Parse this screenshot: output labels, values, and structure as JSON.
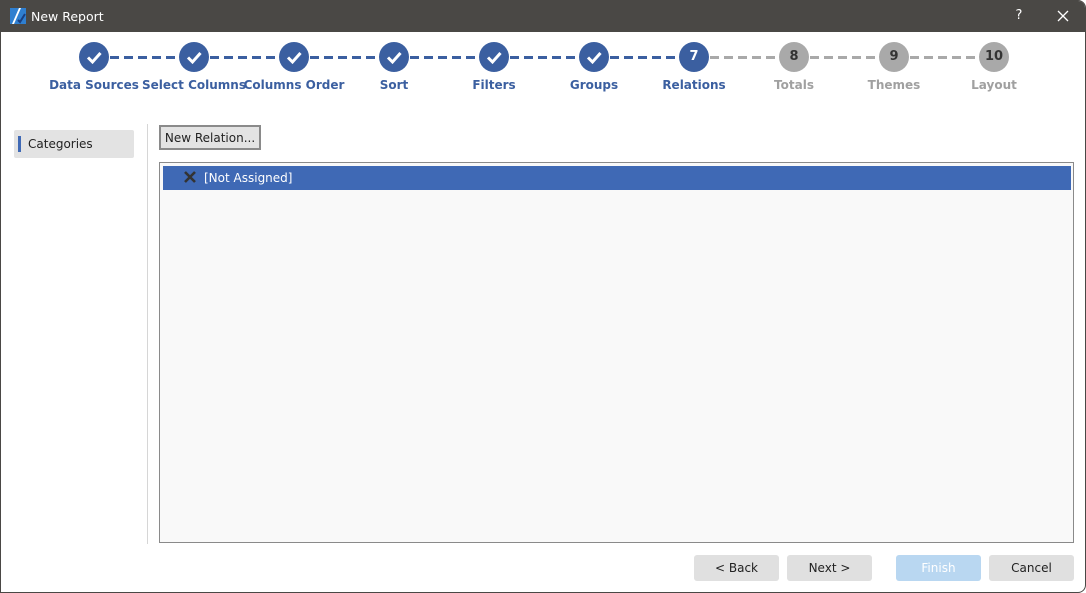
{
  "window": {
    "title": "New Report",
    "help_label": "?"
  },
  "colors": {
    "accent": "#3b5fa0",
    "pending": "#a9a9a9",
    "pending_label": "#a0a0a0",
    "selection": "#3f69b5",
    "titlebar": "#4a4845",
    "finish_disabled": "#b9d7f1"
  },
  "steps": [
    {
      "label": "Data Sources",
      "number": "1",
      "state": "done"
    },
    {
      "label": "Select Columns",
      "number": "2",
      "state": "done"
    },
    {
      "label": "Columns Order",
      "number": "3",
      "state": "done"
    },
    {
      "label": "Sort",
      "number": "4",
      "state": "done"
    },
    {
      "label": "Filters",
      "number": "5",
      "state": "done"
    },
    {
      "label": "Groups",
      "number": "6",
      "state": "done"
    },
    {
      "label": "Relations",
      "number": "7",
      "state": "current"
    },
    {
      "label": "Totals",
      "number": "8",
      "state": "pending"
    },
    {
      "label": "Themes",
      "number": "9",
      "state": "pending"
    },
    {
      "label": "Layout",
      "number": "10",
      "state": "pending"
    }
  ],
  "sidebar": {
    "items": [
      {
        "label": "Categories",
        "selected": true
      }
    ]
  },
  "main": {
    "new_relation_label": "New Relation...",
    "list": [
      {
        "label": "[Not Assigned]",
        "icon": "x-icon",
        "selected": true
      }
    ]
  },
  "footer": {
    "back": "< Back",
    "next": "Next >",
    "finish": "Finish",
    "cancel": "Cancel",
    "finish_enabled": false
  }
}
